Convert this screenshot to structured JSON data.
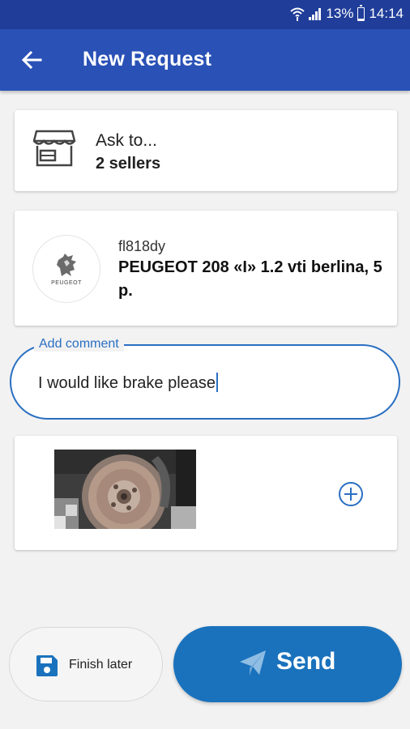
{
  "status_bar": {
    "battery_text": "13%",
    "time": "14:14"
  },
  "app_bar": {
    "title": "New Request",
    "back_icon": "arrow-left-icon"
  },
  "sellers": {
    "icon": "store-icon",
    "ask_label": "Ask to...",
    "count_label": "2 sellers"
  },
  "vehicle": {
    "brand_logo_icon": "peugeot-lion-icon",
    "brand_logo_text": "PEUGEOT",
    "plate": "fl818dy",
    "name": "PEUGEOT 208 «I» 1.2 vti berlina, 5 p."
  },
  "comment": {
    "label": "Add comment",
    "value": "I would like brake please"
  },
  "photos": {
    "items": [
      {
        "type": "photo",
        "subject": "brake disc"
      }
    ],
    "add_icon": "plus-circle-icon"
  },
  "actions": {
    "finish_later_label": "Finish later",
    "send_label": "Send"
  },
  "colors": {
    "status_bar": "#1f3d99",
    "app_bar": "#2a51b6",
    "accent": "#2a6fc2",
    "send_button": "#1a72bd",
    "background": "#f2f2f2"
  }
}
